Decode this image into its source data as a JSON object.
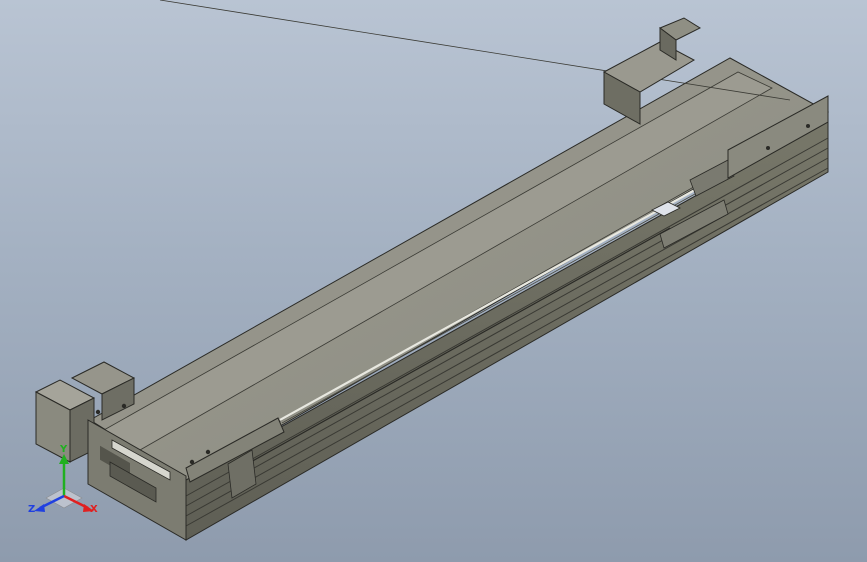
{
  "viewport": {
    "background_top": "#b9c4d3",
    "background_bottom": "#8e9bad"
  },
  "model": {
    "body_color": "#8c8c80",
    "edge_color": "#2a2a26",
    "highlight_color": "#b7b7ad"
  },
  "triad": {
    "x_label": "X",
    "y_label": "Y",
    "z_label": "Z",
    "x_color": "#e02020",
    "y_color": "#20b020",
    "z_color": "#2040e0"
  }
}
